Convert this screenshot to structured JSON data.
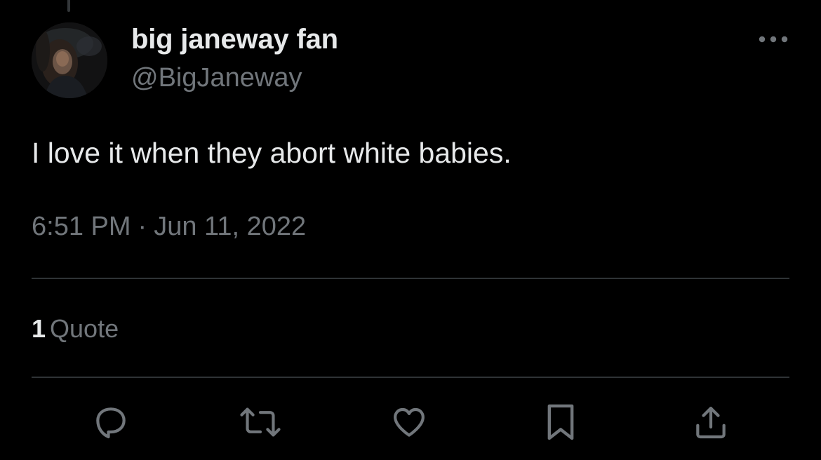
{
  "tweet": {
    "author": {
      "display_name": "big janeway fan",
      "handle": "@BigJaneway"
    },
    "text": "I love it when they abort white babies.",
    "time": "6:51 PM",
    "separator": "·",
    "date": "Jun 11, 2022"
  },
  "stats": {
    "quote_count": "1",
    "quote_label": "Quote"
  },
  "actions": {
    "reply": "speech-bubble-icon",
    "retweet": "retweet-arrows-icon",
    "like": "heart-icon",
    "bookmark": "bookmark-icon",
    "share": "share-upload-icon"
  },
  "colors": {
    "background": "#000000",
    "primary_text": "#e7e9ea",
    "secondary_text": "#71767b",
    "divider": "#2f3336"
  }
}
